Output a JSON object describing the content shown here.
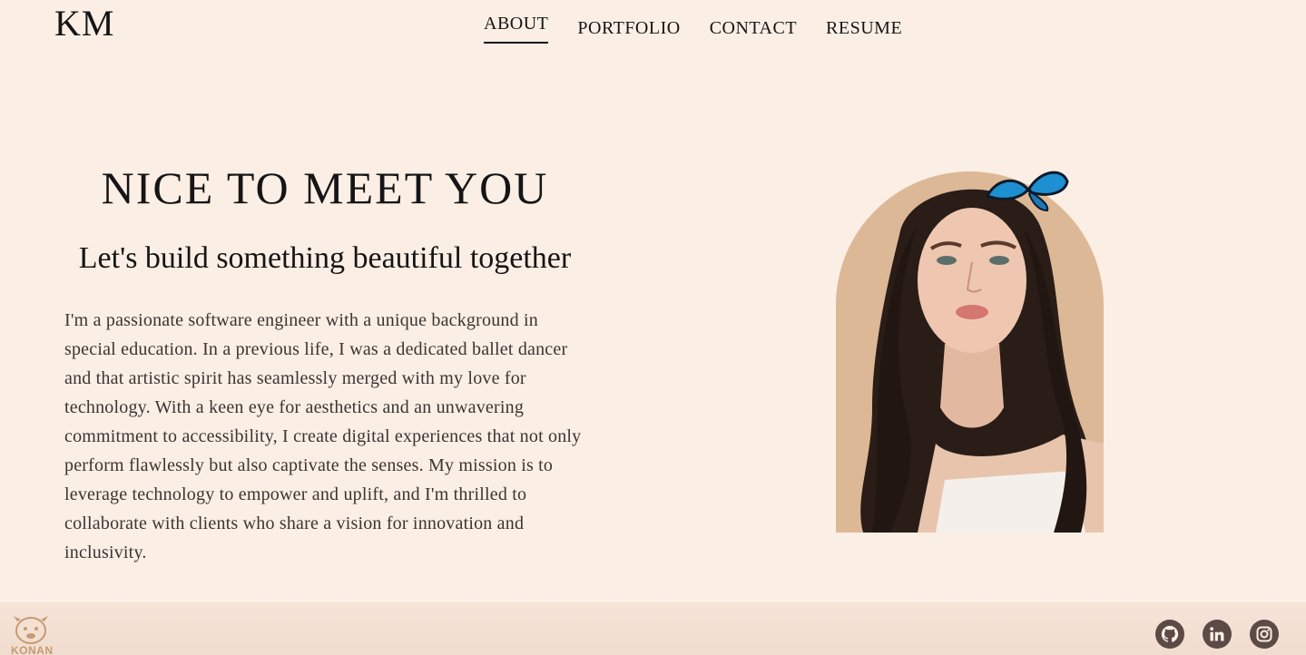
{
  "header": {
    "logo": "KM",
    "nav": [
      {
        "label": "ABOUT",
        "active": true
      },
      {
        "label": "PORTFOLIO",
        "active": false
      },
      {
        "label": "CONTACT",
        "active": false
      },
      {
        "label": "RESUME",
        "active": false
      }
    ]
  },
  "about": {
    "heading": "NICE TO MEET YOU",
    "subheading": "Let's build something beautiful together",
    "bio": "I'm a passionate software engineer with a unique background in special education. In a previous life, I was a dedicated ballet dancer and that artistic spirit has seamlessly merged with my love for technology. With a keen eye for aesthetics and an unwavering commitment to accessibility, I create digital experiences that not only perform flawlessly but also captivate the senses. My mission is to leverage technology to empower and uplift, and I'm thrilled to collaborate with clients who share a vision for innovation and inclusivity."
  },
  "footer": {
    "mascot_text": "KONAN",
    "social": [
      {
        "icon": "github-icon"
      },
      {
        "icon": "linkedin-icon"
      },
      {
        "icon": "instagram-icon"
      }
    ]
  },
  "colors": {
    "background": "#fbefe5",
    "footer": "#f3dfd2",
    "text": "#161414",
    "portrait_bg": "#ddb896",
    "social_icon": "#5c4a46",
    "butterfly": "#1e8fd0"
  }
}
